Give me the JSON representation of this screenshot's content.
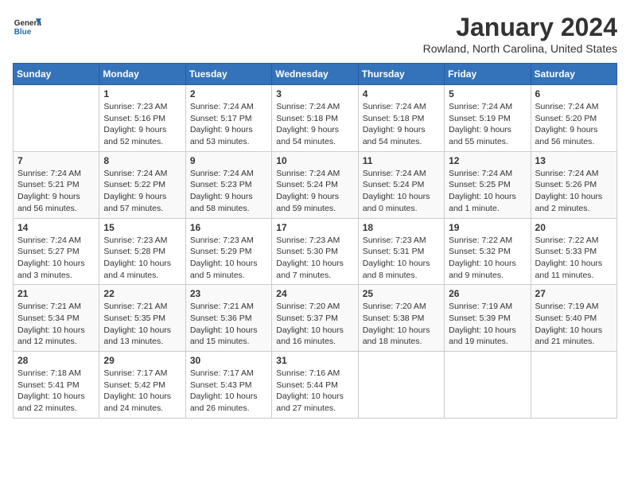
{
  "header": {
    "logo_general": "General",
    "logo_blue": "Blue",
    "title": "January 2024",
    "subtitle": "Rowland, North Carolina, United States"
  },
  "calendar": {
    "days_of_week": [
      "Sunday",
      "Monday",
      "Tuesday",
      "Wednesday",
      "Thursday",
      "Friday",
      "Saturday"
    ],
    "weeks": [
      [
        {
          "day": "",
          "sunrise": "",
          "sunset": "",
          "daylight": ""
        },
        {
          "day": "1",
          "sunrise": "Sunrise: 7:23 AM",
          "sunset": "Sunset: 5:16 PM",
          "daylight": "Daylight: 9 hours and 52 minutes."
        },
        {
          "day": "2",
          "sunrise": "Sunrise: 7:24 AM",
          "sunset": "Sunset: 5:17 PM",
          "daylight": "Daylight: 9 hours and 53 minutes."
        },
        {
          "day": "3",
          "sunrise": "Sunrise: 7:24 AM",
          "sunset": "Sunset: 5:18 PM",
          "daylight": "Daylight: 9 hours and 54 minutes."
        },
        {
          "day": "4",
          "sunrise": "Sunrise: 7:24 AM",
          "sunset": "Sunset: 5:18 PM",
          "daylight": "Daylight: 9 hours and 54 minutes."
        },
        {
          "day": "5",
          "sunrise": "Sunrise: 7:24 AM",
          "sunset": "Sunset: 5:19 PM",
          "daylight": "Daylight: 9 hours and 55 minutes."
        },
        {
          "day": "6",
          "sunrise": "Sunrise: 7:24 AM",
          "sunset": "Sunset: 5:20 PM",
          "daylight": "Daylight: 9 hours and 56 minutes."
        }
      ],
      [
        {
          "day": "7",
          "sunrise": "Sunrise: 7:24 AM",
          "sunset": "Sunset: 5:21 PM",
          "daylight": "Daylight: 9 hours and 56 minutes."
        },
        {
          "day": "8",
          "sunrise": "Sunrise: 7:24 AM",
          "sunset": "Sunset: 5:22 PM",
          "daylight": "Daylight: 9 hours and 57 minutes."
        },
        {
          "day": "9",
          "sunrise": "Sunrise: 7:24 AM",
          "sunset": "Sunset: 5:23 PM",
          "daylight": "Daylight: 9 hours and 58 minutes."
        },
        {
          "day": "10",
          "sunrise": "Sunrise: 7:24 AM",
          "sunset": "Sunset: 5:24 PM",
          "daylight": "Daylight: 9 hours and 59 minutes."
        },
        {
          "day": "11",
          "sunrise": "Sunrise: 7:24 AM",
          "sunset": "Sunset: 5:24 PM",
          "daylight": "Daylight: 10 hours and 0 minutes."
        },
        {
          "day": "12",
          "sunrise": "Sunrise: 7:24 AM",
          "sunset": "Sunset: 5:25 PM",
          "daylight": "Daylight: 10 hours and 1 minute."
        },
        {
          "day": "13",
          "sunrise": "Sunrise: 7:24 AM",
          "sunset": "Sunset: 5:26 PM",
          "daylight": "Daylight: 10 hours and 2 minutes."
        }
      ],
      [
        {
          "day": "14",
          "sunrise": "Sunrise: 7:24 AM",
          "sunset": "Sunset: 5:27 PM",
          "daylight": "Daylight: 10 hours and 3 minutes."
        },
        {
          "day": "15",
          "sunrise": "Sunrise: 7:23 AM",
          "sunset": "Sunset: 5:28 PM",
          "daylight": "Daylight: 10 hours and 4 minutes."
        },
        {
          "day": "16",
          "sunrise": "Sunrise: 7:23 AM",
          "sunset": "Sunset: 5:29 PM",
          "daylight": "Daylight: 10 hours and 5 minutes."
        },
        {
          "day": "17",
          "sunrise": "Sunrise: 7:23 AM",
          "sunset": "Sunset: 5:30 PM",
          "daylight": "Daylight: 10 hours and 7 minutes."
        },
        {
          "day": "18",
          "sunrise": "Sunrise: 7:23 AM",
          "sunset": "Sunset: 5:31 PM",
          "daylight": "Daylight: 10 hours and 8 minutes."
        },
        {
          "day": "19",
          "sunrise": "Sunrise: 7:22 AM",
          "sunset": "Sunset: 5:32 PM",
          "daylight": "Daylight: 10 hours and 9 minutes."
        },
        {
          "day": "20",
          "sunrise": "Sunrise: 7:22 AM",
          "sunset": "Sunset: 5:33 PM",
          "daylight": "Daylight: 10 hours and 11 minutes."
        }
      ],
      [
        {
          "day": "21",
          "sunrise": "Sunrise: 7:21 AM",
          "sunset": "Sunset: 5:34 PM",
          "daylight": "Daylight: 10 hours and 12 minutes."
        },
        {
          "day": "22",
          "sunrise": "Sunrise: 7:21 AM",
          "sunset": "Sunset: 5:35 PM",
          "daylight": "Daylight: 10 hours and 13 minutes."
        },
        {
          "day": "23",
          "sunrise": "Sunrise: 7:21 AM",
          "sunset": "Sunset: 5:36 PM",
          "daylight": "Daylight: 10 hours and 15 minutes."
        },
        {
          "day": "24",
          "sunrise": "Sunrise: 7:20 AM",
          "sunset": "Sunset: 5:37 PM",
          "daylight": "Daylight: 10 hours and 16 minutes."
        },
        {
          "day": "25",
          "sunrise": "Sunrise: 7:20 AM",
          "sunset": "Sunset: 5:38 PM",
          "daylight": "Daylight: 10 hours and 18 minutes."
        },
        {
          "day": "26",
          "sunrise": "Sunrise: 7:19 AM",
          "sunset": "Sunset: 5:39 PM",
          "daylight": "Daylight: 10 hours and 19 minutes."
        },
        {
          "day": "27",
          "sunrise": "Sunrise: 7:19 AM",
          "sunset": "Sunset: 5:40 PM",
          "daylight": "Daylight: 10 hours and 21 minutes."
        }
      ],
      [
        {
          "day": "28",
          "sunrise": "Sunrise: 7:18 AM",
          "sunset": "Sunset: 5:41 PM",
          "daylight": "Daylight: 10 hours and 22 minutes."
        },
        {
          "day": "29",
          "sunrise": "Sunrise: 7:17 AM",
          "sunset": "Sunset: 5:42 PM",
          "daylight": "Daylight: 10 hours and 24 minutes."
        },
        {
          "day": "30",
          "sunrise": "Sunrise: 7:17 AM",
          "sunset": "Sunset: 5:43 PM",
          "daylight": "Daylight: 10 hours and 26 minutes."
        },
        {
          "day": "31",
          "sunrise": "Sunrise: 7:16 AM",
          "sunset": "Sunset: 5:44 PM",
          "daylight": "Daylight: 10 hours and 27 minutes."
        },
        {
          "day": "",
          "sunrise": "",
          "sunset": "",
          "daylight": ""
        },
        {
          "day": "",
          "sunrise": "",
          "sunset": "",
          "daylight": ""
        },
        {
          "day": "",
          "sunrise": "",
          "sunset": "",
          "daylight": ""
        }
      ]
    ]
  }
}
